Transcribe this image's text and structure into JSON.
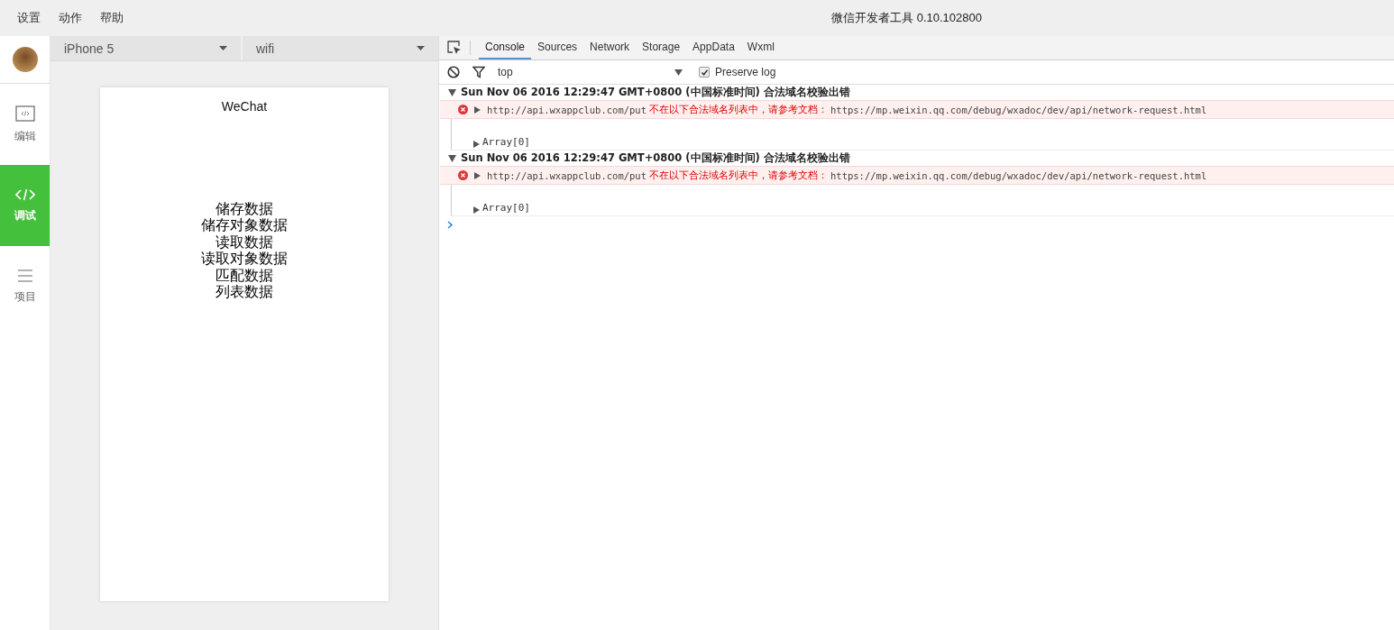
{
  "menu": [
    "设置",
    "动作",
    "帮助"
  ],
  "window": {
    "title": "微信开发者工具 0.10.102800"
  },
  "sidebar": {
    "items": [
      {
        "kind": "edit",
        "label": "编辑",
        "selected": false
      },
      {
        "kind": "debug",
        "label": "调试",
        "selected": true
      },
      {
        "kind": "project",
        "label": "项目",
        "selected": false
      }
    ]
  },
  "simulator": {
    "device": "iPhone 5",
    "network": "wifi",
    "page_title": "WeChat",
    "items": [
      "储存数据",
      "储存对象数据",
      "读取数据",
      "读取对象数据",
      "匹配数据",
      "列表数据"
    ]
  },
  "devtools": {
    "tabs": [
      {
        "label": "Console",
        "selected": true
      },
      {
        "label": "Sources",
        "selected": false
      },
      {
        "label": "Network",
        "selected": false
      },
      {
        "label": "Storage",
        "selected": false
      },
      {
        "label": "AppData",
        "selected": false
      },
      {
        "label": "Wxml",
        "selected": false
      }
    ],
    "context": "top",
    "preserve_log": true,
    "preserve_log_label": "Preserve log",
    "logs": [
      {
        "expanded": true,
        "header": "Sun Nov 06 2016 12:29:47 GMT+0800 (中国标准时间) 合法域名校验出错",
        "url": "http://api.wxappclub.com/put",
        "message": "不在以下合法域名列表中，请参考文档：",
        "link": "https://mp.weixin.qq.com/debug/wxadoc/dev/api/network-request.html",
        "array": "Array[0]"
      },
      {
        "expanded": true,
        "header": "Sun Nov 06 2016 12:29:47 GMT+0800 (中国标准时间) 合法域名校验出错",
        "url": "http://api.wxappclub.com/put",
        "message": "不在以下合法域名列表中，请参考文档：",
        "link": "https://mp.weixin.qq.com/debug/wxadoc/dev/api/network-request.html",
        "array": "Array[0]"
      }
    ]
  }
}
